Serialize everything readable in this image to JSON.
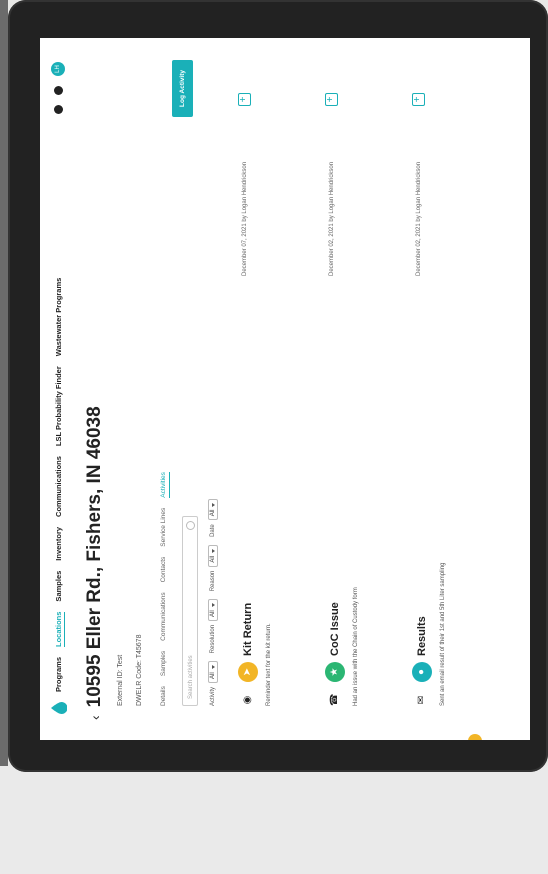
{
  "nav": {
    "items": [
      "Programs",
      "Locations",
      "Samples",
      "Inventory",
      "Communications",
      "LSL Probability Finder",
      "Wastewater Programs"
    ],
    "active_index": 1,
    "avatar_initials": "LH"
  },
  "location": {
    "title": "10595 Eller Rd., Fishers, IN 46038",
    "external_id": "External ID: Test",
    "dweller_code": "DWELR Code: T45678"
  },
  "subtabs": [
    "Details",
    "Samples",
    "Communications",
    "Contacts",
    "Service Lines",
    "Activities"
  ],
  "active_subtab_index": 5,
  "search": {
    "placeholder": "Search activities"
  },
  "filters": {
    "activity_label": "Activity",
    "activity_value": "All",
    "resolution_label": "Resolution",
    "resolution_value": "All",
    "reason_label": "Reason",
    "reason_value": "All",
    "date_label": "Date",
    "date_value": "All"
  },
  "log_button": "Log Activity",
  "activities": [
    {
      "type_icon": "chat-icon",
      "badge_color": "#f2b526",
      "title": "Kit Return",
      "description": "Reminder text for the kit return.",
      "date": "December 07, 2021 by Logan Hendrickson"
    },
    {
      "type_icon": "phone-icon",
      "badge_color": "#2bb673",
      "title": "CoC Issue",
      "description": "Had an issue with the Chain of Custody form",
      "date": "December 02, 2021 by Logan Hendrickson"
    },
    {
      "type_icon": "email-icon",
      "badge_color": "#1ab0b8",
      "title": "Results",
      "description": "Sent an email result of their 1st and 5th Liter sampling",
      "date": "December 02, 2021 by Logan Hendrickson"
    }
  ],
  "colors": {
    "accent": "#1ab0b8",
    "bezel": "#222222",
    "screen": "#ffffff"
  }
}
